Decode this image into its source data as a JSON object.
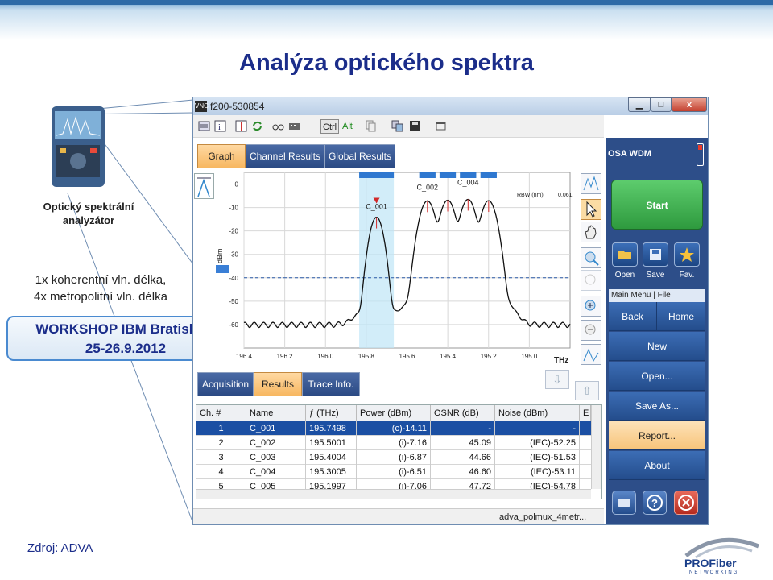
{
  "slide": {
    "title": "Analýza optického spektra",
    "device_label_line1": "Optický spektrální",
    "device_label_line2": "analyzátor",
    "note_line1": "1x koherentní vln. délka,",
    "note_line2": "4x metropolitní vln. délka",
    "workshop_line1": "WORKSHOP IBM Bratislava",
    "workshop_line2": "25-26.9.2012",
    "source": "Zdroj: ADVA",
    "logo_text": "PROFiber NETWORKING",
    "colors": {
      "title": "#1b2d8a",
      "accent": "#4a8ad0"
    }
  },
  "window": {
    "title": "f200-530854",
    "app_icon": "VNC",
    "minimize_icon": "minimize-icon",
    "maximize_icon": "maximize-icon",
    "close_label": "x",
    "toolbar": {
      "ctrl": "Ctrl",
      "alt": "Alt"
    },
    "tabs": [
      "Graph",
      "Channel Results",
      "Global Results"
    ],
    "tabs_active": 0,
    "graph": {
      "rbw_label": "RBW (nm):",
      "rbw_value": "0.061",
      "x_unit": "THz",
      "y_unit": "dBm"
    },
    "bottom_tabs": [
      "Acquisition",
      "Results",
      "Trace Info."
    ],
    "bottom_tabs_active": 1,
    "table": {
      "headers": [
        "Ch. #",
        "Name",
        "ƒ (THz)",
        "Power (dBm)",
        "OSNR (dB)",
        "Noise (dBm)",
        "E"
      ],
      "rows": [
        [
          "1",
          "C_001",
          "195.7498",
          "(c)-14.11",
          "-",
          "-"
        ],
        [
          "2",
          "C_002",
          "195.5001",
          "(i)-7.16",
          "45.09",
          "(IEC)-52.25"
        ],
        [
          "3",
          "C_003",
          "195.4004",
          "(i)-6.87",
          "44.66",
          "(IEC)-51.53"
        ],
        [
          "4",
          "C_004",
          "195.3005",
          "(i)-6.51",
          "46.60",
          "(IEC)-53.11"
        ],
        [
          "5",
          "C_005",
          "195.1997",
          "(i)-7.06",
          "47.72",
          "(IEC)-54.78"
        ]
      ],
      "selected_row": 0
    },
    "status_text": "adva_polmux_4metr..."
  },
  "right_panel": {
    "title": "OSA WDM",
    "start": "Start",
    "open": "Open",
    "save": "Save",
    "fav": "Fav.",
    "menu_header": "Main Menu | File",
    "back": "Back",
    "home": "Home",
    "new": "New",
    "open_file": "Open...",
    "save_as": "Save As...",
    "report": "Report...",
    "about": "About"
  },
  "chart_data": {
    "type": "line",
    "xlabel": "THz",
    "ylabel": "dBm",
    "x_reversed": true,
    "xlim": [
      196.4,
      194.8
    ],
    "ylim": [
      -70,
      5
    ],
    "x_ticks": [
      196.4,
      196.2,
      196.0,
      195.8,
      195.6,
      195.4,
      195.2,
      195.0
    ],
    "x_tick_labels": [
      "196.4",
      "196.2",
      "196.0",
      "195.8",
      "195.6",
      "195.4",
      "195.2",
      "195.0"
    ],
    "y_ticks": [
      0,
      -10,
      -20,
      -30,
      -40,
      -50,
      -60
    ],
    "y_tick_labels": [
      "0",
      "-10",
      "-20",
      "-30",
      "-40",
      "-50",
      "-60"
    ],
    "threshold_dbm": -40,
    "peaks": [
      {
        "name": "C_001",
        "freq_thz": 195.7498,
        "power_dbm": -14.11
      },
      {
        "name": "C_002",
        "freq_thz": 195.5001,
        "power_dbm": -7.16
      },
      {
        "name": "C_003",
        "freq_thz": 195.4004,
        "power_dbm": -6.87
      },
      {
        "name": "C_004",
        "freq_thz": 195.3005,
        "power_dbm": -6.51
      },
      {
        "name": "C_005",
        "freq_thz": 195.1997,
        "power_dbm": -7.06
      }
    ],
    "noise_floor_dbm": -60,
    "peak_labels": [
      "C_001",
      "C_002",
      "C_004"
    ],
    "grid": true
  }
}
